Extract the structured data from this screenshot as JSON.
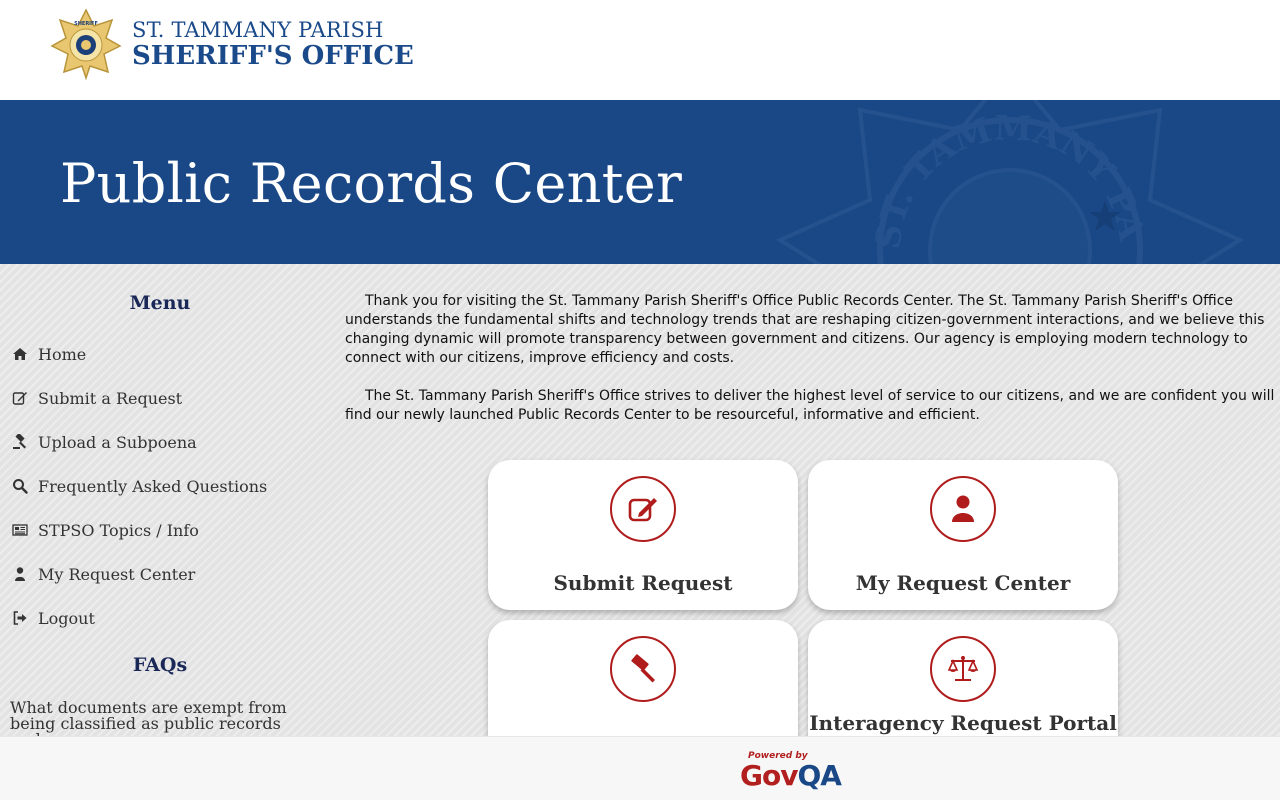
{
  "header": {
    "org_line1": "ST. TAMMANY PARISH",
    "org_line2": "SHERIFF'S OFFICE",
    "badge_text": "SHERIFF"
  },
  "banner": {
    "title": "Public Records Center",
    "seal_text": "ST. TAMMANY PARISH"
  },
  "sidebar": {
    "menu_title": "Menu",
    "items": [
      {
        "label": "Home",
        "icon": "home-icon"
      },
      {
        "label": "Submit a Request",
        "icon": "edit-icon"
      },
      {
        "label": "Upload a Subpoena",
        "icon": "gavel-icon"
      },
      {
        "label": "Frequently Asked Questions",
        "icon": "search-icon"
      },
      {
        "label": "STPSO Topics / Info",
        "icon": "newspaper-icon"
      },
      {
        "label": "My Request Center",
        "icon": "user-icon"
      },
      {
        "label": "Logout",
        "icon": "logout-icon"
      }
    ],
    "faq_title": "FAQs",
    "faq_question": "What documents are exempt from being classified as public records under"
  },
  "content": {
    "paragraph1": "Thank you for visiting the St. Tammany Parish Sheriff's Office Public Records Center. The St. Tammany Parish Sheriff's Office understands the fundamental shifts and technology trends that are reshaping citizen-government interactions, and we believe this changing dynamic will promote transparency between government and citizens. Our agency is employing modern technology to connect with our citizens, improve efficiency and costs.",
    "paragraph2": "The St. Tammany Parish Sheriff's Office strives to deliver the highest level of service to our citizens, and we are confident you will find our newly launched Public Records Center to be resourceful, informative and efficient."
  },
  "cards": [
    {
      "label": "Submit Request",
      "icon": "edit-icon"
    },
    {
      "label": "My Request Center",
      "icon": "user-icon"
    },
    {
      "label": "",
      "icon": "gavel-icon"
    },
    {
      "label": "Interagency Request Portal",
      "icon": "scales-icon"
    }
  ],
  "footer": {
    "powered_by": "Powered by",
    "brand_gov": "Gov",
    "brand_qa": "QA"
  },
  "colors": {
    "brand_blue": "#1a4886",
    "accent_red": "#b01c1c",
    "menu_heading": "#1a2858"
  }
}
